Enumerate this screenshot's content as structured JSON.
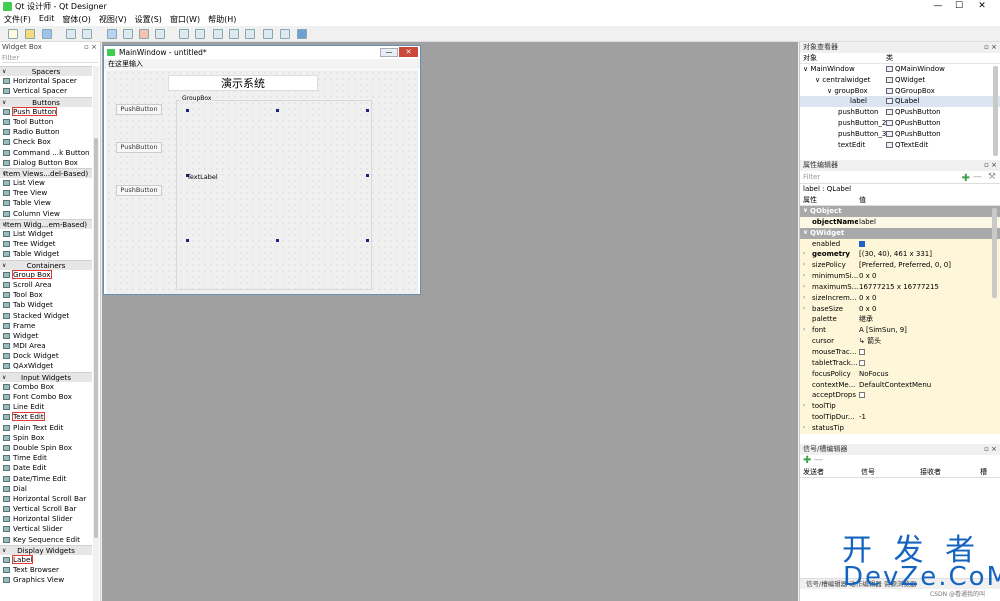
{
  "window": {
    "title": "Qt 设计师 - Qt Designer",
    "minimize": "—",
    "maximize": "☐",
    "close": "✕"
  },
  "menubar": [
    "文件(F)",
    "Edit",
    "窗体(O)",
    "视图(V)",
    "设置(S)",
    "窗口(W)",
    "帮助(H)"
  ],
  "widget_box": {
    "title": "Widget Box",
    "filter_placeholder": "Filter",
    "rows": [
      {
        "type": "cat",
        "label": "Spacers"
      },
      {
        "type": "item",
        "label": "Horizontal Spacer"
      },
      {
        "type": "item",
        "label": "Vertical Spacer"
      },
      {
        "type": "cat",
        "label": "Buttons"
      },
      {
        "type": "item",
        "label": "Push Button",
        "highlight": true
      },
      {
        "type": "item",
        "label": "Tool Button"
      },
      {
        "type": "item",
        "label": "Radio Button"
      },
      {
        "type": "item",
        "label": "Check Box"
      },
      {
        "type": "item",
        "label": "Command ...k Button"
      },
      {
        "type": "item",
        "label": "Dialog Button Box"
      },
      {
        "type": "cat",
        "label": "Item Views...del-Based)"
      },
      {
        "type": "item",
        "label": "List View"
      },
      {
        "type": "item",
        "label": "Tree View"
      },
      {
        "type": "item",
        "label": "Table View"
      },
      {
        "type": "item",
        "label": "Column View"
      },
      {
        "type": "cat",
        "label": "Item Widg...em-Based)"
      },
      {
        "type": "item",
        "label": "List Widget"
      },
      {
        "type": "item",
        "label": "Tree Widget"
      },
      {
        "type": "item",
        "label": "Table Widget"
      },
      {
        "type": "cat",
        "label": "Containers"
      },
      {
        "type": "item",
        "label": "Group Box",
        "highlight": true
      },
      {
        "type": "item",
        "label": "Scroll Area"
      },
      {
        "type": "item",
        "label": "Tool Box"
      },
      {
        "type": "item",
        "label": "Tab Widget"
      },
      {
        "type": "item",
        "label": "Stacked Widget"
      },
      {
        "type": "item",
        "label": "Frame"
      },
      {
        "type": "item",
        "label": "Widget"
      },
      {
        "type": "item",
        "label": "MDI Area"
      },
      {
        "type": "item",
        "label": "Dock Widget"
      },
      {
        "type": "item",
        "label": "QAxWidget"
      },
      {
        "type": "cat",
        "label": "Input Widgets"
      },
      {
        "type": "item",
        "label": "Combo Box"
      },
      {
        "type": "item",
        "label": "Font Combo Box"
      },
      {
        "type": "item",
        "label": "Line Edit"
      },
      {
        "type": "item",
        "label": "Text Edit",
        "highlight": true
      },
      {
        "type": "item",
        "label": "Plain Text Edit"
      },
      {
        "type": "item",
        "label": "Spin Box"
      },
      {
        "type": "item",
        "label": "Double Spin Box"
      },
      {
        "type": "item",
        "label": "Time Edit"
      },
      {
        "type": "item",
        "label": "Date Edit"
      },
      {
        "type": "item",
        "label": "Date/Time Edit"
      },
      {
        "type": "item",
        "label": "Dial"
      },
      {
        "type": "item",
        "label": "Horizontal Scroll Bar"
      },
      {
        "type": "item",
        "label": "Vertical Scroll Bar"
      },
      {
        "type": "item",
        "label": "Horizontal Slider"
      },
      {
        "type": "item",
        "label": "Vertical Slider"
      },
      {
        "type": "item",
        "label": "Key Sequence Edit"
      },
      {
        "type": "cat",
        "label": "Display Widgets"
      },
      {
        "type": "item",
        "label": "Label",
        "highlight": true
      },
      {
        "type": "item",
        "label": "Text Browser"
      },
      {
        "type": "item",
        "label": "Graphics View"
      }
    ]
  },
  "form": {
    "title": "MainWindow - untitled*",
    "menu_item": "在这里输入",
    "title_label": "演示系统",
    "push_buttons": [
      "PushButton",
      "PushButton",
      "PushButton"
    ],
    "groupbox_title": "GroupBox",
    "text_label": "TextLabel"
  },
  "object_inspector": {
    "title": "对象查看器",
    "col_object": "对象",
    "col_class": "类",
    "rows": [
      {
        "name": "MainWindow",
        "cls": "QMainWindow",
        "indent": 12,
        "arrow": "∨"
      },
      {
        "name": "centralwidget",
        "cls": "QWidget",
        "indent": 24,
        "arrow": "∨"
      },
      {
        "name": "groupBox",
        "cls": "QGroupBox",
        "indent": 36,
        "arrow": "∨"
      },
      {
        "name": "label",
        "cls": "QLabel",
        "indent": 50,
        "arrow": "",
        "selected": true
      },
      {
        "name": "pushButton",
        "cls": "QPushButton",
        "indent": 38,
        "arrow": ""
      },
      {
        "name": "pushButton_2",
        "cls": "QPushButton",
        "indent": 38,
        "arrow": ""
      },
      {
        "name": "pushButton_3",
        "cls": "QPushButton",
        "indent": 38,
        "arrow": ""
      },
      {
        "name": "textEdit",
        "cls": "QTextEdit",
        "indent": 38,
        "arrow": ""
      }
    ]
  },
  "property_editor": {
    "title": "属性编辑器",
    "filter_placeholder": "Filter",
    "class_line": "label : QLabel",
    "col_prop": "属性",
    "col_value": "值",
    "rows": [
      {
        "kind": "sec",
        "name": "QObject"
      },
      {
        "kind": "prop",
        "name": "objectName",
        "value": "label",
        "bold": true,
        "shade": "w"
      },
      {
        "kind": "sec",
        "name": "QWidget"
      },
      {
        "kind": "prop",
        "name": "enabled",
        "check": true,
        "shade": "y"
      },
      {
        "kind": "prop",
        "name": "geometry",
        "value": "[(30, 40), 461 x 331]",
        "bold": true,
        "expand": true,
        "shade": "y"
      },
      {
        "kind": "prop",
        "name": "sizePolicy",
        "value": "[Preferred, Preferred, 0, 0]",
        "expand": true,
        "shade": "y"
      },
      {
        "kind": "prop",
        "name": "minimumSi...",
        "value": "0 x 0",
        "expand": true,
        "shade": "y"
      },
      {
        "kind": "prop",
        "name": "maximumS...",
        "value": "16777215 x 16777215",
        "expand": true,
        "shade": "y"
      },
      {
        "kind": "prop",
        "name": "sizeIncrem...",
        "value": "0 x 0",
        "expand": true,
        "shade": "y"
      },
      {
        "kind": "prop",
        "name": "baseSize",
        "value": "0 x 0",
        "expand": true,
        "shade": "y"
      },
      {
        "kind": "prop",
        "name": "palette",
        "value": "继承",
        "shade": "y"
      },
      {
        "kind": "prop",
        "name": "font",
        "value": "A [SimSun, 9]",
        "expand": true,
        "shade": "y"
      },
      {
        "kind": "prop",
        "name": "cursor",
        "value": "↳ 箭头",
        "shade": "y"
      },
      {
        "kind": "prop",
        "name": "mouseTrac...",
        "check": false,
        "shade": "y"
      },
      {
        "kind": "prop",
        "name": "tabletTrack...",
        "check": false,
        "shade": "y"
      },
      {
        "kind": "prop",
        "name": "focusPolicy",
        "value": "NoFocus",
        "shade": "y"
      },
      {
        "kind": "prop",
        "name": "contextMe...",
        "value": "DefaultContextMenu",
        "shade": "y"
      },
      {
        "kind": "prop",
        "name": "acceptDrops",
        "check": false,
        "shade": "y"
      },
      {
        "kind": "prop",
        "name": "toolTip",
        "value": "",
        "expand": true,
        "shade": "y"
      },
      {
        "kind": "prop",
        "name": "toolTipDur...",
        "value": "-1",
        "shade": "y"
      },
      {
        "kind": "prop",
        "name": "statusTip",
        "value": "",
        "expand": true,
        "shade": "y"
      }
    ]
  },
  "signal_editor": {
    "title": "信号/槽编辑器",
    "cols": [
      "发送者",
      "信号",
      "接收者",
      "槽"
    ],
    "tabs": "信号/槽编辑器    动作编辑器    资源浏览器"
  },
  "watermark": {
    "line1": "开 发 者",
    "line2": "DevZe.CoM",
    "credit": "CSDN @看通我的叫"
  },
  "colors": {
    "highlight": "#e53935",
    "canvas": "#a0a0a0",
    "section": "#a9a9a9",
    "accent": "#1565c0"
  }
}
